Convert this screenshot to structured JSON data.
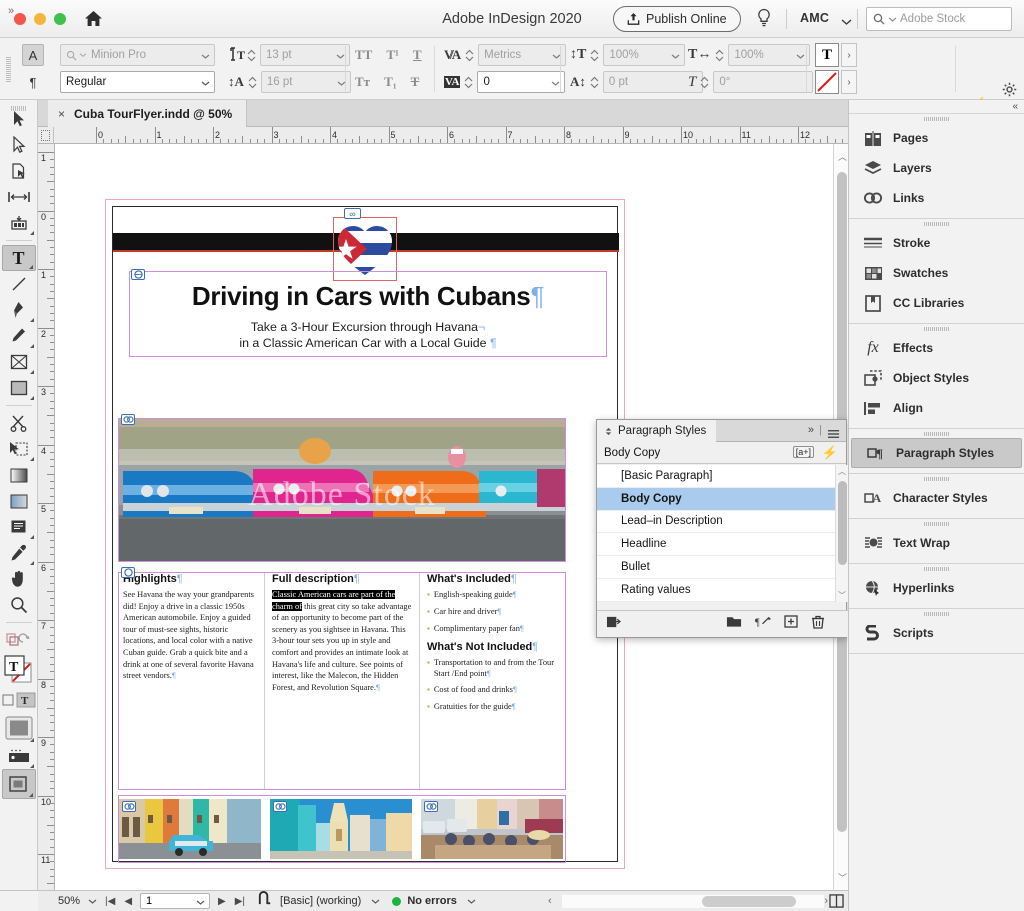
{
  "app": {
    "title": "Adobe InDesign 2020",
    "publish_label": "Publish Online",
    "account": "AMC",
    "stock_placeholder": "Adobe Stock",
    "home_icon": "home-icon",
    "bulb_icon": "lightbulb-icon",
    "search_icon": "search-icon"
  },
  "control_bar": {
    "char_format_button": "A",
    "para_format_button": "¶",
    "font_family": "Minion Pro",
    "font_style": "Regular",
    "font_size": "13 pt",
    "leading": "16 pt",
    "kerning": "Metrics",
    "tracking": "0",
    "vertical_scale": "100%",
    "horizontal_scale": "100%",
    "baseline_shift": "0 pt",
    "skew": "0°",
    "all_caps_icon": "all-caps-icon",
    "superscript_icon": "superscript-icon",
    "underline_icon": "underline-icon",
    "small_caps_icon": "small-caps-icon",
    "subscript_icon": "subscript-icon",
    "strikethrough_icon": "strikethrough-icon",
    "fill_swatch_label": "T",
    "stroke_swatch_label": "none-slash",
    "quick_apply_icon": "lightning-icon",
    "gear_icon": "gear-icon",
    "menu_icon": "hamburger-icon"
  },
  "document_tab": {
    "close_label": "×",
    "name": "Cuba TourFlyer.indd @ 50%"
  },
  "toolbox": {
    "collapse_label": "»",
    "tools": [
      {
        "name": "selection-tool",
        "glyph": "▶",
        "selected": false,
        "has_flyout": false
      },
      {
        "name": "direct-selection-tool",
        "glyph": "▷",
        "selected": false,
        "has_flyout": false
      },
      {
        "name": "page-tool",
        "glyph": "page",
        "selected": false,
        "has_flyout": false
      },
      {
        "name": "gap-tool",
        "glyph": "gap",
        "selected": false,
        "has_flyout": false
      },
      {
        "name": "content-collector-tool",
        "glyph": "collector",
        "selected": false,
        "has_flyout": true
      },
      {
        "name": "type-tool",
        "glyph": "T",
        "selected": true,
        "has_flyout": true
      },
      {
        "name": "line-tool",
        "glyph": "line",
        "selected": false,
        "has_flyout": false
      },
      {
        "name": "pen-tool",
        "glyph": "pen",
        "selected": false,
        "has_flyout": true
      },
      {
        "name": "pencil-tool",
        "glyph": "pencil",
        "selected": false,
        "has_flyout": true
      },
      {
        "name": "frame-tool",
        "glyph": "frame",
        "selected": false,
        "has_flyout": true
      },
      {
        "name": "rectangle-tool",
        "glyph": "rect",
        "selected": false,
        "has_flyout": true
      },
      {
        "name": "scissors-tool",
        "glyph": "scissors",
        "selected": false,
        "has_flyout": false
      },
      {
        "name": "free-transform-tool",
        "glyph": "transform",
        "selected": false,
        "has_flyout": true
      },
      {
        "name": "gradient-swatch-tool",
        "glyph": "gradient",
        "selected": false,
        "has_flyout": false
      },
      {
        "name": "gradient-feather-tool",
        "glyph": "feather",
        "selected": false,
        "has_flyout": false
      },
      {
        "name": "note-tool",
        "glyph": "note",
        "selected": false,
        "has_flyout": true
      },
      {
        "name": "eyedropper-tool",
        "glyph": "eyedropper",
        "selected": false,
        "has_flyout": true
      },
      {
        "name": "hand-tool",
        "glyph": "hand",
        "selected": false,
        "has_flyout": false
      },
      {
        "name": "zoom-tool",
        "glyph": "zoom",
        "selected": false,
        "has_flyout": false
      }
    ],
    "fill_label": "T",
    "stroke_label": "none",
    "apply_color_icons": [
      "apply-color-icon",
      "apply-none-icon"
    ],
    "screen_mode_icon": "screen-mode-icon",
    "preview_mode_icon": "preview-mode-icon"
  },
  "rulers": {
    "h_ticks": [
      "0",
      "1",
      "2",
      "3",
      "4",
      "5",
      "6",
      "7",
      "8",
      "9",
      "10",
      "11",
      "12"
    ],
    "v_ticks": [
      "1",
      "0",
      "1",
      "2",
      "3",
      "4",
      "5",
      "6",
      "7",
      "8",
      "9",
      "10",
      "11"
    ],
    "units": "inches"
  },
  "flyer": {
    "headline": "Driving in Cars with Cubans",
    "headline_pilcrow": "¶",
    "subline_1": "Take a 3-Hour Excursion through Havana",
    "subline_2": "in a Classic American Car with a Local Guide",
    "watermark": "Adobe Stock",
    "columns": [
      {
        "heading": "Highlights",
        "body_plain": "See Havana the way your grandparents did! Enjoy a drive in a classic 1950s American automobile. Enjoy a guided tour of must-see sights, historic locations, and local color with a native Cuban guide. Grab a quick bite and a drink at one of several favorite Havana street vendors."
      },
      {
        "heading": "Full description",
        "body_highlighted": "Classic American cars are part of the charm of",
        "body_rest": " this great city so take advantage of an opportunity to become part of the scenery as you sightsee in Havana. This 3-hour tour sets you up in style and comfort and provides an intimate look at Havana's life and culture. See points of interest, like the Malecon, the Hidden Forest, and Revolution Square."
      },
      {
        "heading": "What's Included",
        "items": [
          "English-speaking guide",
          "Car hire and driver",
          "Complimentary paper fan"
        ],
        "heading2": "What's Not Included",
        "items2": [
          "Transportation to and from the Tour Start /End point",
          "Cost of food and drinks",
          "Gratuities for the guide"
        ]
      }
    ]
  },
  "paragraph_styles_panel": {
    "tab_title": "Paragraph Styles",
    "current_style": "Body Copy",
    "clear_override_label": "[a+]",
    "quick_apply_icon": "lightning-icon",
    "collapse_icon": "double-chevron-icon",
    "menu_icon": "panel-menu-icon",
    "styles": [
      "[Basic Paragraph]",
      "Body Copy",
      "Lead–in Description",
      "Headline",
      "Bullet",
      "Rating values"
    ],
    "selected_style": "Body Copy",
    "footer_icons": [
      "load-styles-icon",
      "new-group-icon",
      "clear-overrides-icon",
      "new-style-icon",
      "delete-style-icon"
    ]
  },
  "dock": {
    "collapse_label": "«",
    "groups": [
      {
        "items": [
          {
            "label": "Pages",
            "icon": "pages-icon",
            "selected": false
          },
          {
            "label": "Layers",
            "icon": "layers-icon",
            "selected": false
          },
          {
            "label": "Links",
            "icon": "links-icon",
            "selected": false
          }
        ]
      },
      {
        "items": [
          {
            "label": "Stroke",
            "icon": "stroke-icon",
            "selected": false
          },
          {
            "label": "Swatches",
            "icon": "swatches-icon",
            "selected": false
          },
          {
            "label": "CC Libraries",
            "icon": "cc-libraries-icon",
            "selected": false
          }
        ]
      },
      {
        "items": [
          {
            "label": "Effects",
            "icon": "effects-fx-icon",
            "selected": false
          },
          {
            "label": "Object Styles",
            "icon": "object-styles-icon",
            "selected": false
          },
          {
            "label": "Align",
            "icon": "align-icon",
            "selected": false
          }
        ]
      },
      {
        "items": [
          {
            "label": "Paragraph Styles",
            "icon": "paragraph-styles-icon",
            "selected": true
          }
        ]
      },
      {
        "items": [
          {
            "label": "Character Styles",
            "icon": "character-styles-icon",
            "selected": false
          }
        ]
      },
      {
        "items": [
          {
            "label": "Text Wrap",
            "icon": "text-wrap-icon",
            "selected": false
          }
        ]
      },
      {
        "items": [
          {
            "label": "Hyperlinks",
            "icon": "hyperlinks-icon",
            "selected": false
          }
        ]
      },
      {
        "items": [
          {
            "label": "Scripts",
            "icon": "scripts-icon",
            "selected": false
          }
        ]
      }
    ]
  },
  "status_bar": {
    "zoom": "50%",
    "page_number": "1",
    "first_icon": "first-page-icon",
    "prev_icon": "prev-page-icon",
    "next_icon": "next-page-icon",
    "last_icon": "last-page-icon",
    "master_icon": "master-page-icon",
    "master_label": "[Basic] (working)",
    "preflight_label": "No errors",
    "preflight_color": "#1cb53b",
    "layout_icon": "layout-view-icon"
  }
}
